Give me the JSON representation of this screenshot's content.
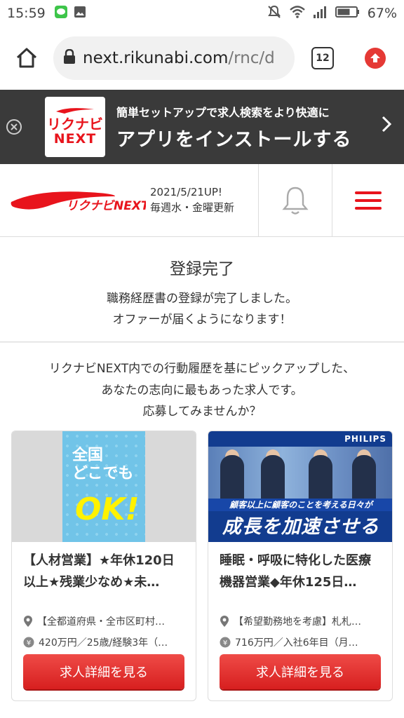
{
  "status_bar": {
    "time": "15:59",
    "battery": "67%",
    "icons": [
      "line-icon",
      "image-icon",
      "mute-icon",
      "wifi-icon",
      "signal-icon",
      "battery-icon"
    ]
  },
  "browser": {
    "url_host": "next.rikunabi.com",
    "url_path": "/rnc/d",
    "tab_count": "12"
  },
  "app_banner": {
    "logo_line1": "リクナビ",
    "logo_line2": "NEXT",
    "subtitle": "簡単セットアップで求人検索をより快適に",
    "title": "アプリをインストールする"
  },
  "header": {
    "logo_text": "リクナビNEXT",
    "update_date": "2021/5/21UP!",
    "update_schedule": "毎週水・金曜更新"
  },
  "completion": {
    "title": "登録完了",
    "line1": "職務経歴書の登録が完了しました。",
    "line2": "オファーが届くようになります！"
  },
  "recommend": {
    "intro1": "リクナビNEXT内での行動履歴を基にピックアップした、",
    "intro2": "あなたの志向に最もあった求人です。",
    "intro3": "応募してみませんか？",
    "jobs": [
      {
        "image_line1": "全国",
        "image_line2": "どこでも",
        "image_line3": "OK!",
        "title": "【人材営業】★年休120日以上★残業少なめ★未…",
        "location": "【全都道府県・全市区町村…",
        "salary": "420万円／25歳/経験3年（…",
        "button": "求人詳細を見る"
      },
      {
        "image_brand": "PHILIPS",
        "image_caption": "顧客以上に顧客のことを考える日々が",
        "image_headline": "成長を加速させる",
        "title": "睡眠・呼吸に特化した医療機器営業◆年休125日…",
        "location": "【希望勤務地を考慮】札札…",
        "salary": "716万円／入社6年目（月…",
        "button": "求人詳細を見る"
      }
    ]
  },
  "colors": {
    "brand_red": "#e8141c",
    "banner_bg": "#3a3a3a",
    "button_red": "#d71f1f"
  }
}
